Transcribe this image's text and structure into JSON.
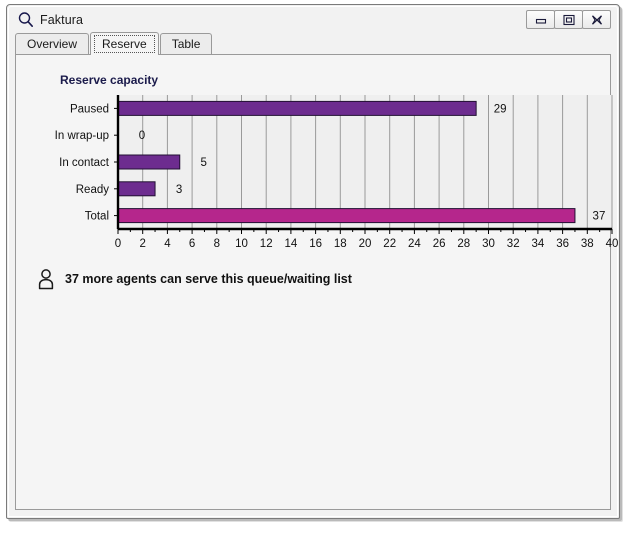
{
  "window": {
    "title": "Faktura",
    "title_icon": "magnifier-icon",
    "controls": {
      "minimize": "Minimize",
      "maximize": "Maximize",
      "close": "Close"
    }
  },
  "tabs": [
    {
      "label": "Overview",
      "selected": false
    },
    {
      "label": "Reserve",
      "selected": true
    },
    {
      "label": "Table",
      "selected": false
    }
  ],
  "footer": {
    "icon": "agent-person-icon",
    "text": "37 more agents can serve this queue/waiting list"
  },
  "colors": {
    "bar_purple": "#6d2c8f",
    "bar_magenta": "#b5268c",
    "bar_border": "#221133",
    "plot_background": "#efefef",
    "gridline": "#9a9a9a",
    "axis": "#000000",
    "title_text": "#1b1b4b"
  },
  "chart_data": {
    "type": "bar",
    "orientation": "horizontal",
    "title": "Reserve capacity",
    "xlabel": "",
    "ylabel": "",
    "categories": [
      "Paused",
      "In wrap-up",
      "In contact",
      "Ready",
      "Total"
    ],
    "values": [
      29,
      0,
      5,
      3,
      37
    ],
    "data_labels": [
      "29",
      "0",
      "5",
      "3",
      "37"
    ],
    "bar_colors": [
      "#6d2c8f",
      "#6d2c8f",
      "#6d2c8f",
      "#6d2c8f",
      "#b5268c"
    ],
    "xlim": [
      0,
      40
    ],
    "xticks": [
      0,
      2,
      4,
      6,
      8,
      10,
      12,
      14,
      16,
      18,
      20,
      22,
      24,
      26,
      28,
      30,
      32,
      34,
      36,
      38,
      40
    ],
    "xtick_labels": [
      "0",
      "2",
      "4",
      "6",
      "8",
      "10",
      "12",
      "14",
      "16",
      "18",
      "20",
      "22",
      "24",
      "26",
      "28",
      "30",
      "32",
      "34",
      "36",
      "38",
      "40"
    ],
    "minor_tick_step": 1,
    "grid": "vertical",
    "legend": null
  }
}
